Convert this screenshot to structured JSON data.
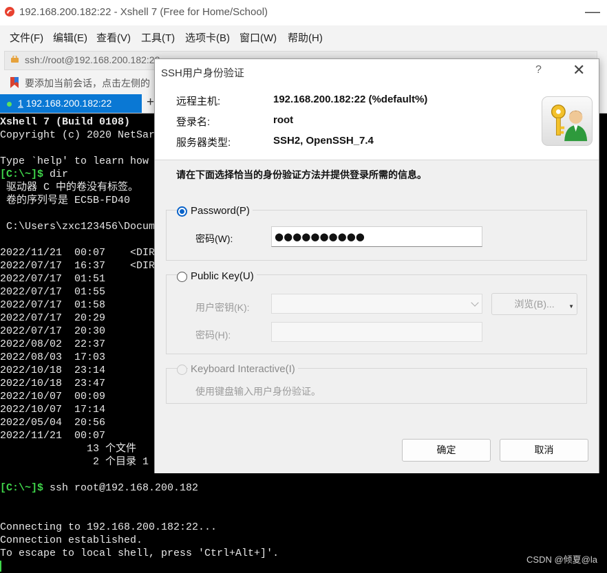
{
  "window": {
    "title": "192.168.200.182:22 - Xshell 7 (Free for Home/School)",
    "minimize_glyph": "—"
  },
  "menu": [
    "文件(F)",
    "编辑(E)",
    "查看(V)",
    "工具(T)",
    "选项卡(B)",
    "窗口(W)",
    "帮助(H)"
  ],
  "address": {
    "url": "ssh://root@192.168.200.182:22"
  },
  "notice": {
    "text": "要添加当前会话，点击左侧的"
  },
  "tabs": [
    {
      "number": "1",
      "label": "192.168.200.182:22",
      "status_color": "#5de15d"
    }
  ],
  "new_tab_glyph": "+",
  "terminal": {
    "banner": "Xshell 7 (Build 0108)",
    "copyright": "Copyright (c) 2020 NetSar",
    "help_line": "Type `help' to learn how",
    "prompt": "[C:\\~]$",
    "cmd1": " dir",
    "vol1": " 驱动器 C 中的卷没有标签。",
    "vol2": " 卷的序列号是 EC5B-FD40",
    "dir_of": " C:\\Users\\zxc123456\\Docum",
    "listing": [
      "2022/11/21  00:07    <DIR",
      "2022/07/17  16:37    <DIR",
      "2022/07/17  01:51",
      "2022/07/17  01:55",
      "2022/07/17  01:58",
      "2022/07/17  20:29",
      "2022/07/17  20:30",
      "2022/08/02  22:37",
      "2022/08/03  17:03",
      "2022/10/18  23:14",
      "2022/10/18  23:47",
      "2022/10/07  00:09",
      "2022/10/07  17:14",
      "2022/05/04  20:56",
      "2022/11/21  00:07"
    ],
    "files_summary": "              13 个文件",
    "dirs_summary": "               2 个目录 1",
    "cmd2": " ssh root@192.168.200.182",
    "connecting": "Connecting to 192.168.200.182:22...",
    "established": "Connection established.",
    "escape": "To escape to local shell, press 'Ctrl+Alt+]'.",
    "prompt_color": "#3fd64a"
  },
  "watermark": "CSDN @倾夏@la",
  "dialog": {
    "title": "SSH用户身份验证",
    "help_glyph": "?",
    "close_glyph": "✕",
    "remote_host_label": "远程主机:",
    "remote_host": "192.168.200.182:22 (%default%)",
    "login_label": "登录名:",
    "login": "root",
    "server_type_label": "服务器类型:",
    "server_type": "SSH2, OpenSSH_7.4",
    "hint": "请在下面选择恰当的身份验证方法并提供登录所需的信息。",
    "password_option": "Password(P)",
    "password_field_label": "密码(W):",
    "password_value": "●●●●●●●●●●",
    "publickey_option": "Public Key(U)",
    "user_key_label": "用户密钥(K):",
    "user_key_value": "",
    "browse_button": "浏览(B)...",
    "passphrase_label": "密码(H):",
    "passphrase_value": "",
    "keyboard_option": "Keyboard Interactive(I)",
    "keyboard_hint": "使用键盘输入用户身份验证。",
    "ok_button": "确定",
    "cancel_button": "取消",
    "accent_color": "#0a63c9"
  }
}
